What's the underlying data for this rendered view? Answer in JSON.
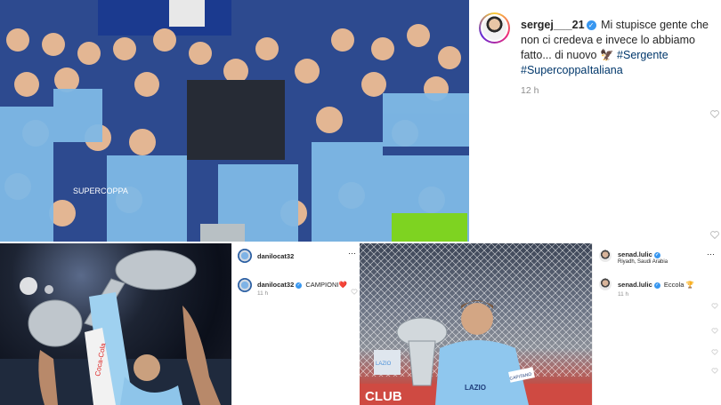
{
  "top_post": {
    "username": "sergej___21",
    "caption": "Mi stupisce gente che non ci credeva e invece lo abbiamo fatto... di nuovo",
    "eagle_icon": "🦅",
    "hashtags": [
      "#Sergente",
      "#SupercoppaItaliana"
    ],
    "time": "12 h",
    "photo_text": "SUPERCOPPA"
  },
  "bottom_left_post": {
    "header_username": "danilocat32",
    "comment_username": "danilocat32",
    "comment_text": "CAMPIONI",
    "heart_icon": "❤️",
    "time": "11 h",
    "photo_text": "Coca-Cola"
  },
  "bottom_right_post": {
    "header_username": "senad.lulic",
    "location": "Riyadh, Saudi Arabia",
    "comment_username": "senad.lulic",
    "comment_text": "Eccola",
    "trophy_icon": "🏆",
    "time": "11 h",
    "banner_text": "CLUB",
    "shirt_text": "LAZIO",
    "armband_text": "CAPITANO",
    "score_board_text": "LAZIO"
  },
  "icons": {
    "verified": "✓",
    "more": "⋯",
    "heart": "heart-outline"
  },
  "colors": {
    "hashtag": "#00376b",
    "verified": "#3897f0",
    "lazio_blue": "#7fb9e6"
  }
}
